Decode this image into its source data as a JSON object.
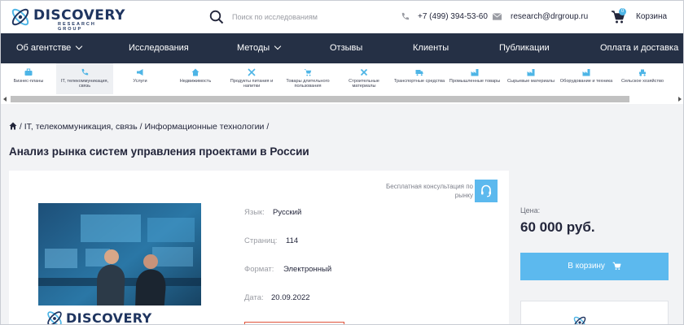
{
  "header": {
    "logo_word": "DISCOVERY",
    "logo_sub": "RESEARCH GROUP",
    "search_placeholder": "Поиск по исследованиям",
    "phone": "+7 (499) 394-53-60",
    "email": "research@drgroup.ru",
    "cart_count": "0",
    "cart_label": "Корзина"
  },
  "nav": {
    "items": [
      "Об агентстве",
      "Исследования",
      "Методы",
      "Отзывы",
      "Клиенты",
      "Публикации",
      "Оплата и доставка"
    ]
  },
  "categories": [
    {
      "label": "Бизнес-планы",
      "icon": "briefcase-icon"
    },
    {
      "label": "IT, телекоммуникация, связь",
      "icon": "phone-icon"
    },
    {
      "label": "Услуги",
      "icon": "megaphone-icon"
    },
    {
      "label": "Недвижимость",
      "icon": "house-icon"
    },
    {
      "label": "Продукты питания и напитки",
      "icon": "cutlery-icon"
    },
    {
      "label": "Товары длительного пользования",
      "icon": "cart-icon"
    },
    {
      "label": "Строительные материалы",
      "icon": "tools-icon"
    },
    {
      "label": "Транспортные средства",
      "icon": "truck-icon"
    },
    {
      "label": "Промышленные товары",
      "icon": "factory-icon"
    },
    {
      "label": "Сырьевые материалы",
      "icon": "factory-icon"
    },
    {
      "label": "Оборудование и техника",
      "icon": "factory-icon"
    },
    {
      "label": "Сельское хозяйство",
      "icon": "tractor-icon"
    }
  ],
  "breadcrumb": {
    "items": [
      "IT, телекоммуникация, связь",
      "Информационные технологии"
    ]
  },
  "page_title": "Анализ рынка систем управления проектами в России",
  "consult": {
    "label": "Бесплатная консультация по рынку"
  },
  "meta": [
    {
      "label": "Язык:",
      "value": "Русский"
    },
    {
      "label": "Страниц:",
      "value": "114"
    },
    {
      "label": "Формат:",
      "value": "Электронный"
    },
    {
      "label": "Дата:",
      "value": "20.09.2022"
    }
  ],
  "cover": {
    "logo_word": "DISCOVERY"
  },
  "side": {
    "price_label": "Цена:",
    "price": "60 000 руб.",
    "buy_label": "В корзину"
  },
  "colors": {
    "accent": "#5cb9ee",
    "nav_bg": "#253045",
    "brand": "#1f3560"
  }
}
